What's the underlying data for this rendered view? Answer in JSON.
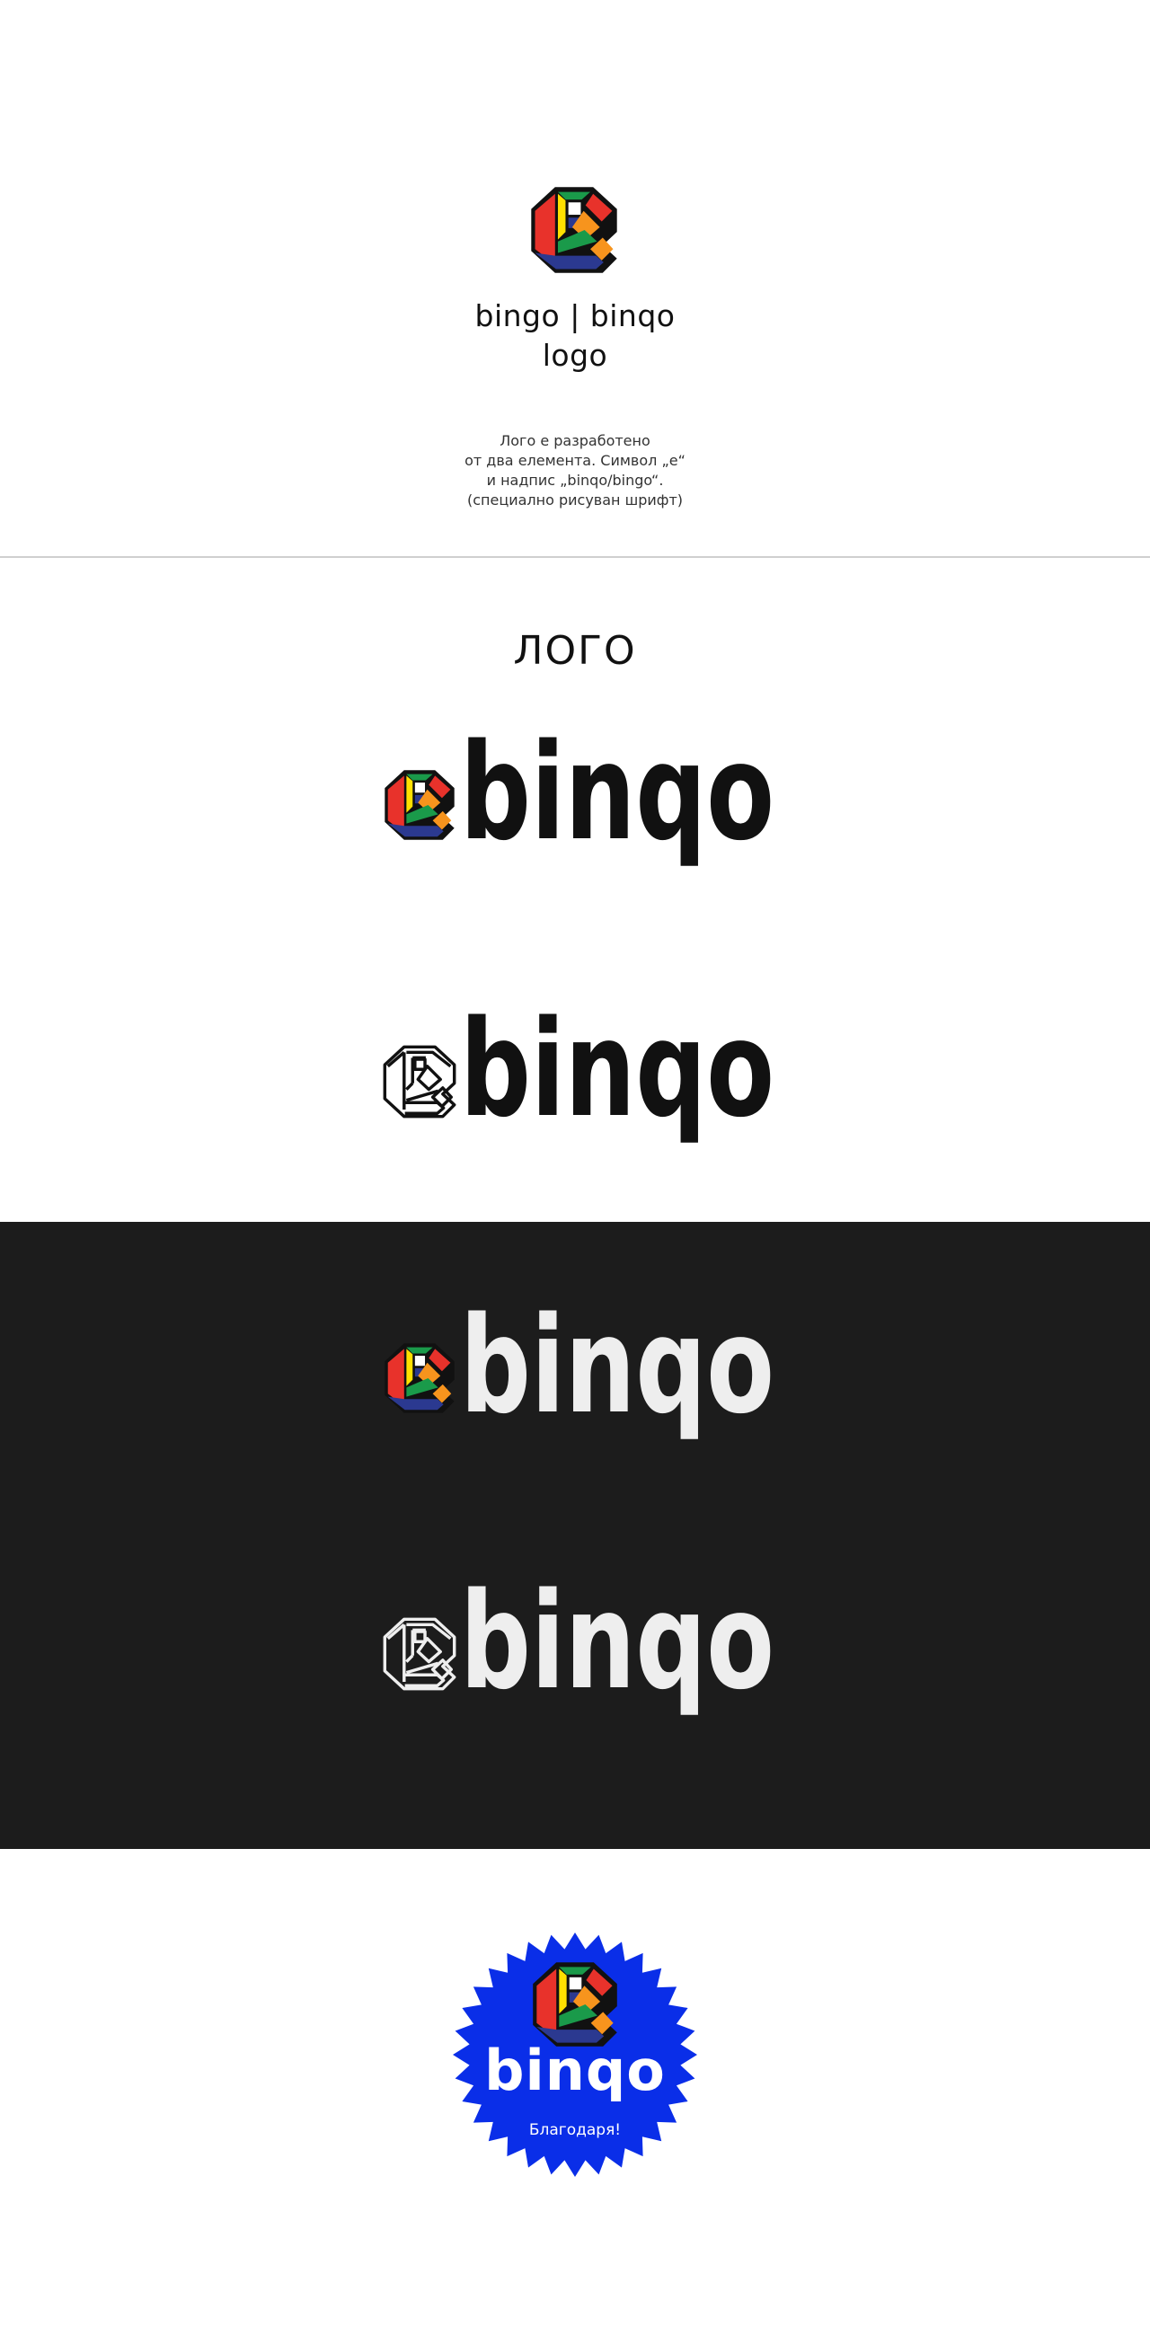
{
  "header": {
    "title_line1": "bingo | binqo",
    "title_line2": "logo",
    "description": [
      "Лого е разработено",
      "от два елемента. Символ „е“",
      "и надпис „binqo/bingo“.",
      "(специално рисуван шрифт)"
    ]
  },
  "section": {
    "title": "ЛОГО"
  },
  "logo": {
    "wordmark": "binqo",
    "colors": {
      "red": "#e8322b",
      "yellow": "#ffe000",
      "green": "#1a9a4a",
      "navy": "#2b3990",
      "orange": "#f7941d",
      "outline": "#111111",
      "dark_background": "#1c1c1c",
      "light_wordmark": "#eeeeee",
      "badge_blue": "#0a2ee8"
    }
  },
  "badge": {
    "word": "binqo",
    "thanks": "Благодаря!"
  }
}
